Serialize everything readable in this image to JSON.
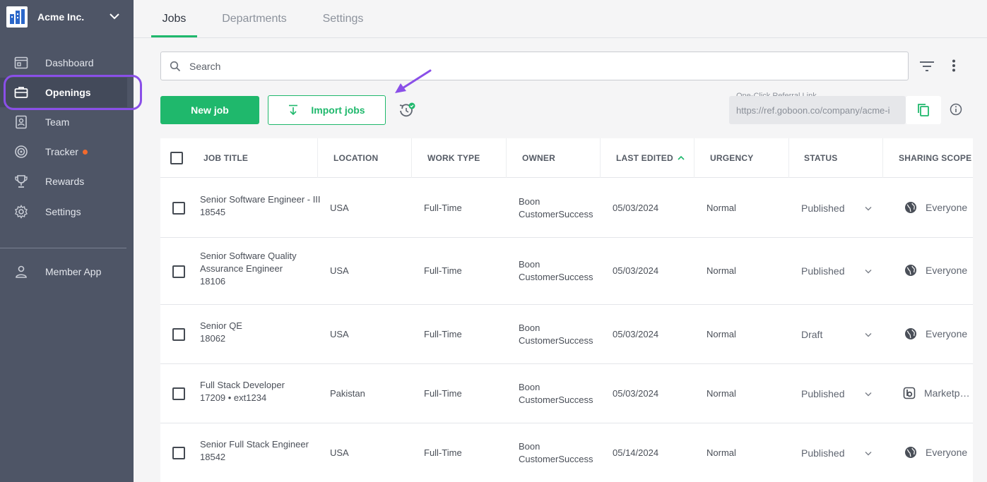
{
  "sidebar": {
    "org_name": "Acme Inc.",
    "items": [
      {
        "label": "Dashboard",
        "icon": "dashboard-icon"
      },
      {
        "label": "Openings",
        "icon": "briefcase-icon",
        "active": true
      },
      {
        "label": "Team",
        "icon": "contacts-book-icon"
      },
      {
        "label": "Tracker",
        "icon": "target-icon",
        "badge": "notification-dot"
      },
      {
        "label": "Rewards",
        "icon": "trophy-icon"
      },
      {
        "label": "Settings",
        "icon": "gear-icon"
      }
    ],
    "member_app": {
      "label": "Member App",
      "icon": "person-icon"
    }
  },
  "tabs": [
    {
      "label": "Jobs",
      "active": true
    },
    {
      "label": "Departments"
    },
    {
      "label": "Settings"
    }
  ],
  "search": {
    "placeholder": "Search"
  },
  "toolbar": {
    "new_job_label": "New job",
    "import_jobs_label": "Import jobs",
    "referral_label": "One-Click Referral Link",
    "referral_url": "https://ref.goboon.co/company/acme-i"
  },
  "table": {
    "columns": [
      "JOB TITLE",
      "LOCATION",
      "WORK TYPE",
      "OWNER",
      "LAST EDITED",
      "URGENCY",
      "STATUS",
      "SHARING SCOPE"
    ],
    "sorted_column": "LAST EDITED",
    "sort_direction": "ascending",
    "rows": [
      {
        "title": [
          "Senior Software Engineer - III",
          "18545"
        ],
        "location": "USA",
        "work_type": "Full-Time",
        "owner": [
          "Boon",
          "CustomerSuccess"
        ],
        "last_edited": "05/03/2024",
        "urgency": "Normal",
        "status": "Published",
        "scope": "Everyone",
        "scope_icon": "globe-icon"
      },
      {
        "title": [
          "Senior Software Quality",
          "Assurance Engineer",
          "18106"
        ],
        "location": "USA",
        "work_type": "Full-Time",
        "owner": [
          "Boon",
          "CustomerSuccess"
        ],
        "last_edited": "05/03/2024",
        "urgency": "Normal",
        "status": "Published",
        "scope": "Everyone",
        "scope_icon": "globe-icon"
      },
      {
        "title": [
          "Senior QE",
          "18062"
        ],
        "location": "USA",
        "work_type": "Full-Time",
        "owner": [
          "Boon",
          "CustomerSuccess"
        ],
        "last_edited": "05/03/2024",
        "urgency": "Normal",
        "status": "Draft",
        "scope": "Everyone",
        "scope_icon": "globe-icon"
      },
      {
        "title": [
          "Full Stack Developer",
          "17209 • ext1234"
        ],
        "location": "Pakistan",
        "work_type": "Full-Time",
        "owner": [
          "Boon",
          "CustomerSuccess"
        ],
        "last_edited": "05/03/2024",
        "urgency": "Normal",
        "status": "Published",
        "scope": "Marketp…",
        "scope_icon": "marketplace-icon"
      },
      {
        "title": [
          "Senior Full Stack Engineer",
          "18542"
        ],
        "location": "USA",
        "work_type": "Full-Time",
        "owner": [
          "Boon",
          "CustomerSuccess"
        ],
        "last_edited": "05/14/2024",
        "urgency": "Normal",
        "status": "Published",
        "scope": "Everyone",
        "scope_icon": "globe-icon"
      }
    ]
  },
  "colors": {
    "sidebar_bg": "#4e5566",
    "accent_green": "#1fb86c",
    "highlight_purple": "#8a4fe8",
    "tracker_dot": "#f26a2d"
  }
}
